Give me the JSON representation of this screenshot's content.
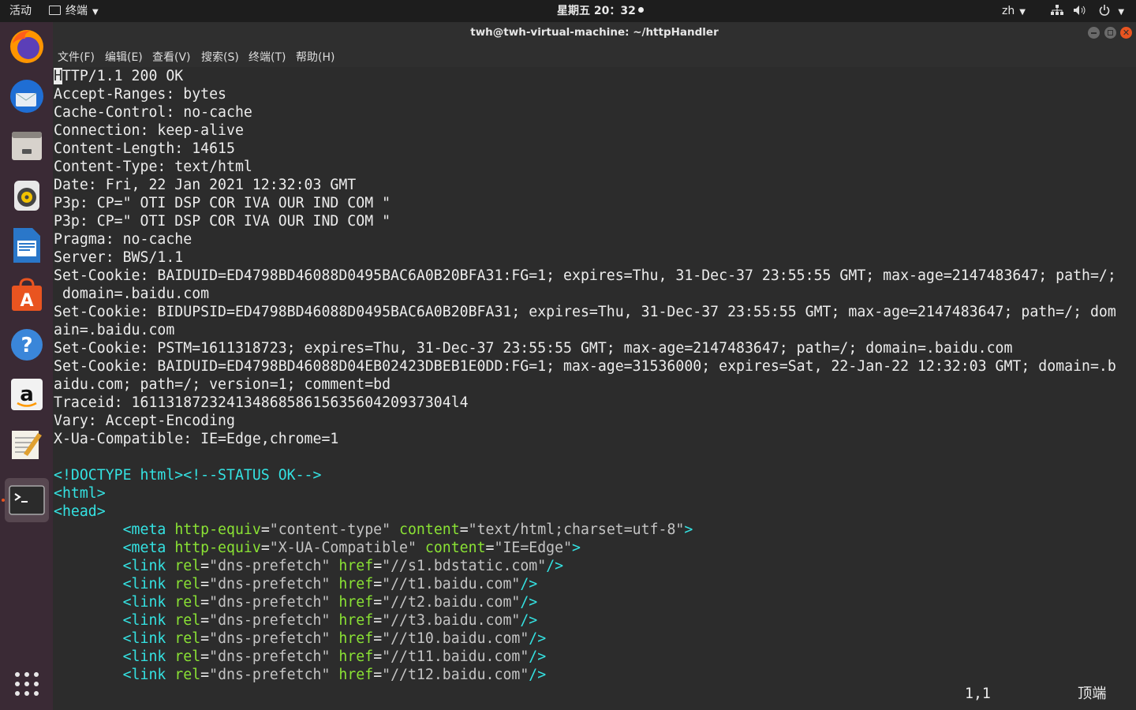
{
  "topbar": {
    "activities": "活动",
    "app_name": "终端",
    "clock": "星期五 20：32",
    "lang": "zh"
  },
  "window": {
    "title": "twh@twh-virtual-machine: ~/httpHandler"
  },
  "menu": [
    "文件(F)",
    "编辑(E)",
    "查看(V)",
    "搜索(S)",
    "终端(T)",
    "帮助(H)"
  ],
  "dock": [
    {
      "name": "firefox-icon",
      "active": false
    },
    {
      "name": "thunderbird-icon",
      "active": false
    },
    {
      "name": "files-icon",
      "active": false
    },
    {
      "name": "rhythmbox-icon",
      "active": false
    },
    {
      "name": "writer-icon",
      "active": false
    },
    {
      "name": "software-icon",
      "active": false
    },
    {
      "name": "help-icon",
      "active": false
    },
    {
      "name": "amazon-icon",
      "active": false
    },
    {
      "name": "text-editor-icon",
      "active": false
    },
    {
      "name": "terminal-icon",
      "active": true
    },
    {
      "name": "show-apps-icon",
      "active": false
    }
  ],
  "headers": [
    "HTTP/1.1 200 OK",
    "Accept-Ranges: bytes",
    "Cache-Control: no-cache",
    "Connection: keep-alive",
    "Content-Length: 14615",
    "Content-Type: text/html",
    "Date: Fri, 22 Jan 2021 12:32:03 GMT",
    "P3p: CP=\" OTI DSP COR IVA OUR IND COM \"",
    "P3p: CP=\" OTI DSP COR IVA OUR IND COM \"",
    "Pragma: no-cache",
    "Server: BWS/1.1",
    "Set-Cookie: BAIDUID=ED4798BD46088D0495BAC6A0B20BFA31:FG=1; expires=Thu, 31-Dec-37 23:55:55 GMT; max-age=2147483647; path=/;",
    " domain=.baidu.com",
    "Set-Cookie: BIDUPSID=ED4798BD46088D0495BAC6A0B20BFA31; expires=Thu, 31-Dec-37 23:55:55 GMT; max-age=2147483647; path=/; dom",
    "ain=.baidu.com",
    "Set-Cookie: PSTM=1611318723; expires=Thu, 31-Dec-37 23:55:55 GMT; max-age=2147483647; path=/; domain=.baidu.com",
    "Set-Cookie: BAIDUID=ED4798BD46088D04EB02423DBEB1E0DD:FG=1; max-age=31536000; expires=Sat, 22-Jan-22 12:32:03 GMT; domain=.b",
    "aidu.com; path=/; version=1; comment=bd",
    "Traceid: 1611318723241348685861563560420937304l4",
    "Vary: Accept-Encoding",
    "X-Ua-Compatible: IE=Edge,chrome=1",
    ""
  ],
  "html_lines": [
    [
      [
        "<!DOCTYPE html><!--STATUS OK-->",
        "tag"
      ]
    ],
    [
      [
        "<html>",
        "tag"
      ]
    ],
    [
      [
        "<head>",
        "tag"
      ]
    ],
    [
      [
        "        <meta ",
        "tag"
      ],
      [
        "http-equiv",
        "attr"
      ],
      [
        "=",
        "plain"
      ],
      [
        "\"content-type\"",
        "str"
      ],
      [
        " content",
        "attr"
      ],
      [
        "=",
        "plain"
      ],
      [
        "\"text/html;charset=utf-8\"",
        "str"
      ],
      [
        ">",
        "tag"
      ]
    ],
    [
      [
        "        <meta ",
        "tag"
      ],
      [
        "http-equiv",
        "attr"
      ],
      [
        "=",
        "plain"
      ],
      [
        "\"X-UA-Compatible\"",
        "str"
      ],
      [
        " content",
        "attr"
      ],
      [
        "=",
        "plain"
      ],
      [
        "\"IE=Edge\"",
        "str"
      ],
      [
        ">",
        "tag"
      ]
    ],
    [
      [
        "        <link ",
        "tag"
      ],
      [
        "rel",
        "attr"
      ],
      [
        "=",
        "plain"
      ],
      [
        "\"dns-prefetch\"",
        "str"
      ],
      [
        " href",
        "attr"
      ],
      [
        "=",
        "plain"
      ],
      [
        "\"//s1.bdstatic.com\"",
        "str"
      ],
      [
        "/>",
        "tag"
      ]
    ],
    [
      [
        "        <link ",
        "tag"
      ],
      [
        "rel",
        "attr"
      ],
      [
        "=",
        "plain"
      ],
      [
        "\"dns-prefetch\"",
        "str"
      ],
      [
        " href",
        "attr"
      ],
      [
        "=",
        "plain"
      ],
      [
        "\"//t1.baidu.com\"",
        "str"
      ],
      [
        "/>",
        "tag"
      ]
    ],
    [
      [
        "        <link ",
        "tag"
      ],
      [
        "rel",
        "attr"
      ],
      [
        "=",
        "plain"
      ],
      [
        "\"dns-prefetch\"",
        "str"
      ],
      [
        " href",
        "attr"
      ],
      [
        "=",
        "plain"
      ],
      [
        "\"//t2.baidu.com\"",
        "str"
      ],
      [
        "/>",
        "tag"
      ]
    ],
    [
      [
        "        <link ",
        "tag"
      ],
      [
        "rel",
        "attr"
      ],
      [
        "=",
        "plain"
      ],
      [
        "\"dns-prefetch\"",
        "str"
      ],
      [
        " href",
        "attr"
      ],
      [
        "=",
        "plain"
      ],
      [
        "\"//t3.baidu.com\"",
        "str"
      ],
      [
        "/>",
        "tag"
      ]
    ],
    [
      [
        "        <link ",
        "tag"
      ],
      [
        "rel",
        "attr"
      ],
      [
        "=",
        "plain"
      ],
      [
        "\"dns-prefetch\"",
        "str"
      ],
      [
        " href",
        "attr"
      ],
      [
        "=",
        "plain"
      ],
      [
        "\"//t10.baidu.com\"",
        "str"
      ],
      [
        "/>",
        "tag"
      ]
    ],
    [
      [
        "        <link ",
        "tag"
      ],
      [
        "rel",
        "attr"
      ],
      [
        "=",
        "plain"
      ],
      [
        "\"dns-prefetch\"",
        "str"
      ],
      [
        " href",
        "attr"
      ],
      [
        "=",
        "plain"
      ],
      [
        "\"//t11.baidu.com\"",
        "str"
      ],
      [
        "/>",
        "tag"
      ]
    ],
    [
      [
        "        <link ",
        "tag"
      ],
      [
        "rel",
        "attr"
      ],
      [
        "=",
        "plain"
      ],
      [
        "\"dns-prefetch\"",
        "str"
      ],
      [
        " href",
        "attr"
      ],
      [
        "=",
        "plain"
      ],
      [
        "\"//t12.baidu.com\"",
        "str"
      ],
      [
        "/>",
        "tag"
      ]
    ]
  ],
  "status": {
    "position": "1,1",
    "scroll": "顶端"
  },
  "colors": {
    "tag": "#34e2e2",
    "attr": "#8ae234",
    "str": "#c4c4c4",
    "plain": "#ececec"
  }
}
